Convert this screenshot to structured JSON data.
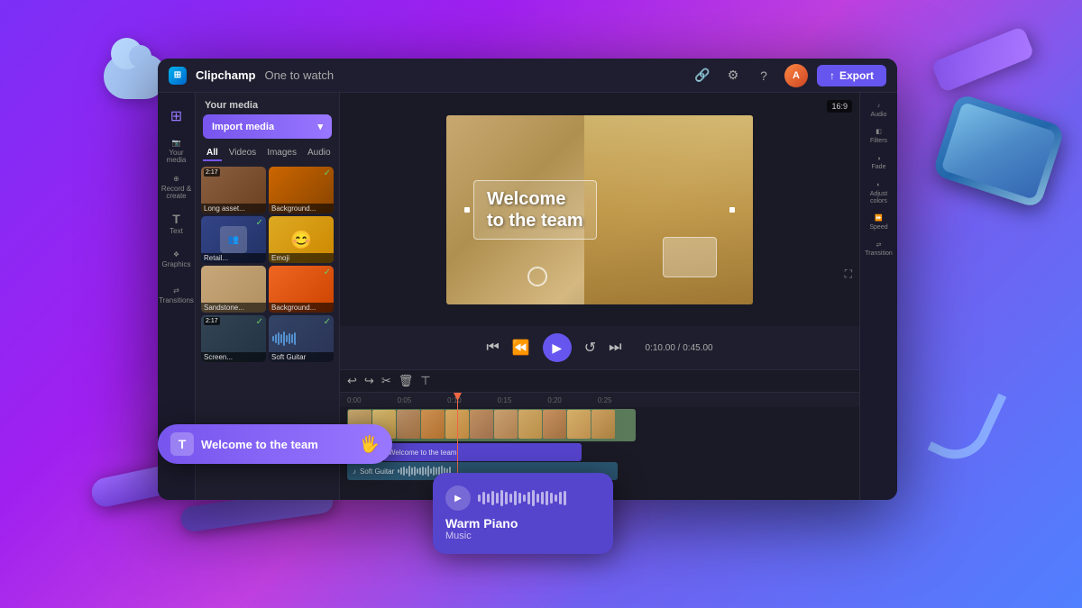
{
  "app": {
    "name": "Clipchamp",
    "project_name": "One to watch",
    "export_label": "Export",
    "aspect_ratio": "16:9"
  },
  "header": {
    "tabs": [
      "All",
      "Videos",
      "Images",
      "Audio"
    ],
    "active_tab": "All",
    "import_label": "Import media",
    "timecode": "0:10.00 / 0:45.00"
  },
  "sidebar_left": {
    "items": [
      {
        "icon": "⊞",
        "label": ""
      },
      {
        "icon": "📷",
        "label": "Your media"
      },
      {
        "icon": "⊕",
        "label": "Record & create"
      },
      {
        "icon": "T",
        "label": "Text"
      },
      {
        "icon": "❖",
        "label": "Graphics"
      },
      {
        "icon": "⟷",
        "label": "Transitions"
      }
    ]
  },
  "media_items": [
    {
      "label": "Long asset...",
      "duration": "2:17",
      "type": "video",
      "color": "brown"
    },
    {
      "label": "Background...",
      "duration": "",
      "type": "image",
      "color": "orange",
      "checked": true
    },
    {
      "label": "Retail...",
      "duration": "",
      "type": "image",
      "color": "blue",
      "checked": true
    },
    {
      "label": "Emoji",
      "duration": "",
      "type": "image",
      "color": "yellow"
    },
    {
      "label": "Sandstone...",
      "duration": "",
      "type": "image",
      "color": "sand"
    },
    {
      "label": "Background...",
      "duration": "",
      "type": "image",
      "color": "fire",
      "checked": true
    },
    {
      "label": "Screen...",
      "duration": "2:17",
      "type": "video",
      "color": "screen"
    },
    {
      "label": "Soft Guitar",
      "duration": "",
      "type": "audio",
      "color": "wave",
      "checked": true
    }
  ],
  "preview": {
    "video_text": "Welcome\nto the team",
    "timecode": "0:10.00 / 0:45.00"
  },
  "timeline": {
    "time_markers": [
      "0:00",
      "0:05",
      "0:10",
      "0:15",
      "0:20",
      "0:25"
    ],
    "timecode": "0:10.00 / 0:45.00"
  },
  "right_panel": {
    "items": [
      {
        "icon": "♪",
        "label": "Audio"
      },
      {
        "icon": "◧",
        "label": "Filters"
      },
      {
        "icon": "◑",
        "label": "Fade"
      },
      {
        "icon": "◑",
        "label": "Adjust colors"
      },
      {
        "icon": "⏩",
        "label": "Speed"
      },
      {
        "icon": "⟷",
        "label": "Transition"
      }
    ]
  },
  "floating": {
    "text_track_label": "Welcome to the team",
    "warm_piano_title": "Warm Piano",
    "warm_piano_subtitle": "Music",
    "soft_guitar_label": "Soft Guitar"
  },
  "toolbar_icons": {
    "undo": "↩",
    "redo": "↪",
    "cut": "✂",
    "delete": "🗑",
    "split": "⊤"
  }
}
